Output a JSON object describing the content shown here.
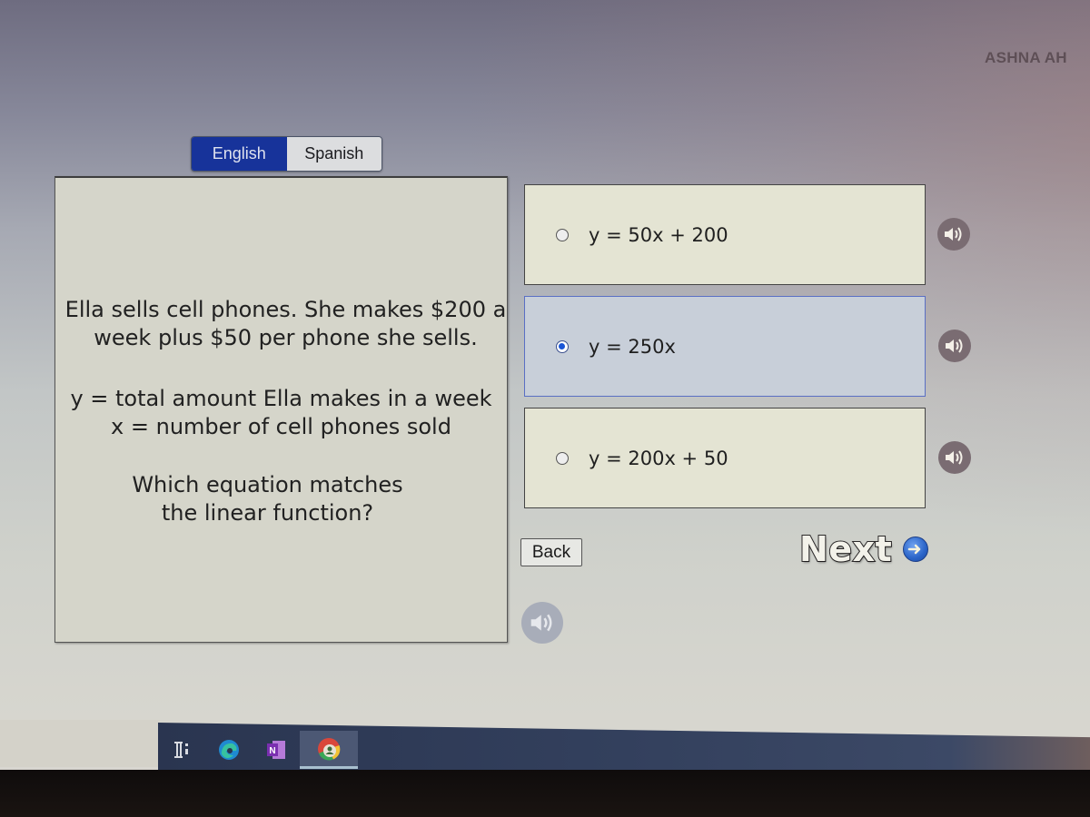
{
  "user": {
    "name": "ASHNA AH"
  },
  "language_toggle": {
    "options": [
      {
        "label": "English",
        "selected": true
      },
      {
        "label": "Spanish",
        "selected": false
      }
    ]
  },
  "question": {
    "intro": "Ella sells cell phones. She makes $200 a week plus $50 per phone she sells.",
    "intro_lines": [
      "Ella sells cell phones. She makes $200 a",
      "week plus $50 per phone she sells."
    ],
    "variables": [
      "y = total amount Ella makes in a week",
      "x = number of cell phones sold"
    ],
    "prompt_lines": [
      "Which equation matches",
      "the linear function?"
    ]
  },
  "choices": [
    {
      "label": "y = 50x + 200",
      "selected": false,
      "audio_icon": "speaker-icon"
    },
    {
      "label": "y = 250x",
      "selected": true,
      "audio_icon": "speaker-icon"
    },
    {
      "label": "y = 200x + 50",
      "selected": false,
      "audio_icon": "speaker-icon"
    }
  ],
  "navigation": {
    "back_label": "Back",
    "next_label": "Next",
    "next_icon": "arrow-right-circle-icon",
    "question_audio_icon": "speaker-icon"
  },
  "taskbar": {
    "apps": [
      {
        "name": "task-view",
        "icon": "task-view-icon",
        "active": false
      },
      {
        "name": "Microsoft Edge",
        "icon": "edge-icon",
        "active": false
      },
      {
        "name": "OneNote",
        "icon": "onenote-icon",
        "active": false
      },
      {
        "name": "Google Chrome",
        "icon": "chrome-icon",
        "active": true
      }
    ]
  },
  "colors": {
    "english_active": "#17339a",
    "selected_choice_bg": "#c8cfd9",
    "choice_bg": "#e4e4d3",
    "panel_bg": "#d5d5ca",
    "radio_selected": "#1a55d6"
  }
}
